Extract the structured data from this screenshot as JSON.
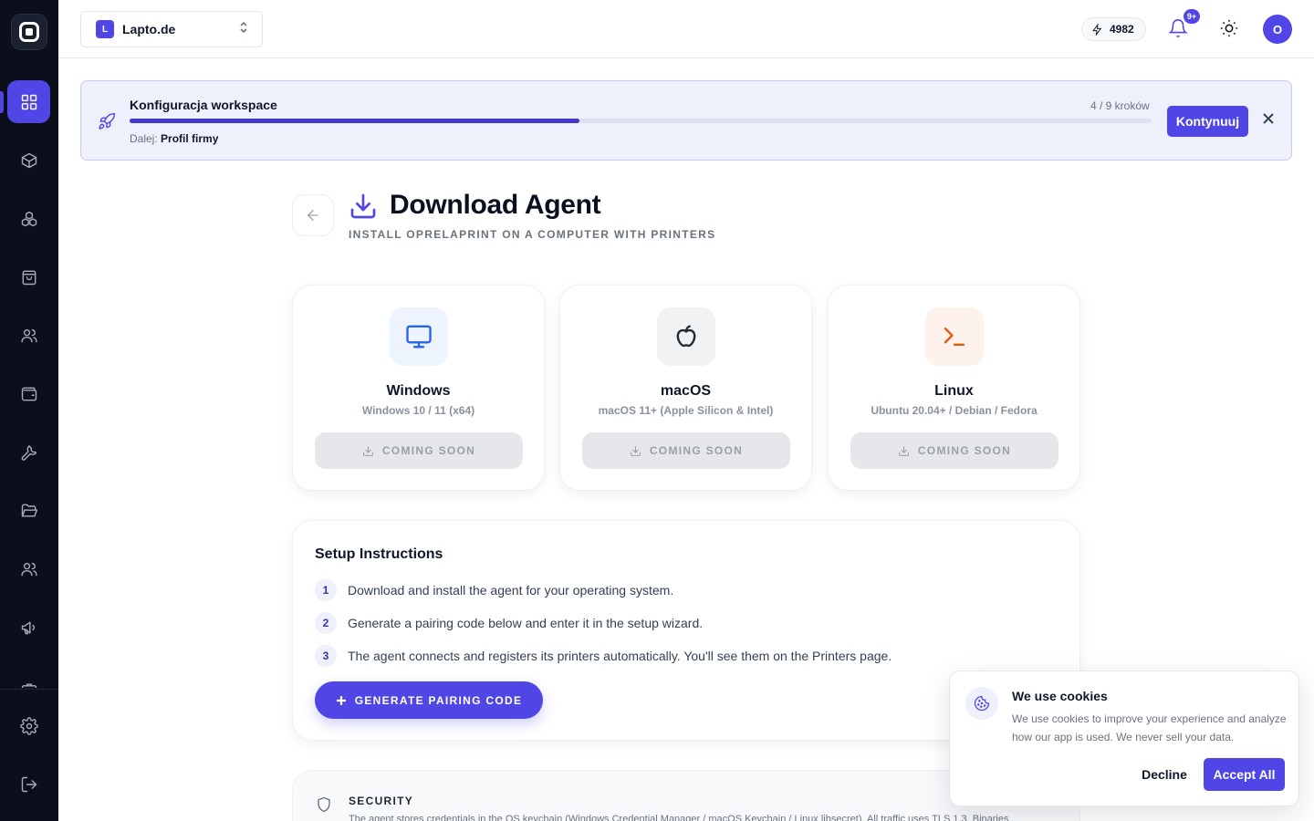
{
  "workspace": {
    "initial": "L",
    "name": "Lapto.de"
  },
  "header": {
    "credits": "4982",
    "notifications_badge": "9+",
    "avatar_initial": "O"
  },
  "sidebar": {
    "items": [
      {
        "name": "dashboard",
        "icon": "grid-icon",
        "active": true
      },
      {
        "name": "products",
        "icon": "box-icon"
      },
      {
        "name": "integrations",
        "icon": "cubes-icon"
      },
      {
        "name": "orders",
        "icon": "shopping-bag-icon"
      },
      {
        "name": "customers",
        "icon": "users-icon"
      },
      {
        "name": "wallet",
        "icon": "wallet-icon"
      },
      {
        "name": "tools",
        "icon": "wrench-icon"
      },
      {
        "name": "files",
        "icon": "folder-open-icon"
      },
      {
        "name": "team",
        "icon": "users-icon"
      },
      {
        "name": "marketing",
        "icon": "megaphone-icon"
      },
      {
        "name": "settings",
        "icon": "gear-icon"
      },
      {
        "name": "logout",
        "icon": "logout-icon"
      }
    ]
  },
  "banner": {
    "title": "Konfiguracja workspace",
    "steps": "4 / 9 kroków",
    "progress": 0.44,
    "next_label": "Dalej:",
    "next_value": "Profil firmy",
    "continue_label": "Kontynuuj"
  },
  "page": {
    "title": "Download Agent",
    "subtitle": "INSTALL OPRELAPRINT ON A COMPUTER WITH PRINTERS"
  },
  "os_cards": [
    {
      "name": "Windows",
      "requirements": "Windows 10 / 11 (x64)",
      "button": "COMING SOON",
      "icon": "monitor-icon",
      "icon_bg": "#eef4fe",
      "icon_color": "#2563eb"
    },
    {
      "name": "macOS",
      "requirements": "macOS 11+ (Apple Silicon & Intel)",
      "button": "COMING SOON",
      "icon": "apple-icon",
      "icon_bg": "#f1f2f4",
      "icon_color": "#1f2937"
    },
    {
      "name": "Linux",
      "requirements": "Ubuntu 20.04+ / Debian / Fedora",
      "button": "COMING SOON",
      "icon": "terminal-icon",
      "icon_bg": "#fdf3ec",
      "icon_color": "#ea580c"
    }
  ],
  "setup": {
    "title": "Setup Instructions",
    "steps": [
      {
        "num": "1",
        "text": "Download and install the agent for your operating system."
      },
      {
        "num": "2",
        "text": "Generate a pairing code below and enter it in the setup wizard."
      },
      {
        "num": "3",
        "text": "The agent connects and registers its printers automatically. You'll see them on the Printers page."
      }
    ],
    "generate_label": "GENERATE PAIRING CODE"
  },
  "security": {
    "title": "SECURITY",
    "text": "The agent stores credentials in the OS keychain (Windows Credential Manager / macOS Keychain / Linux libsecret). All traffic uses TLS 1.3. Binaries"
  },
  "cookies": {
    "title": "We use cookies",
    "text": "We use cookies to improve your experience and analyze how our app is used. We never sell your data.",
    "decline_label": "Decline",
    "accept_label": "Accept All"
  }
}
